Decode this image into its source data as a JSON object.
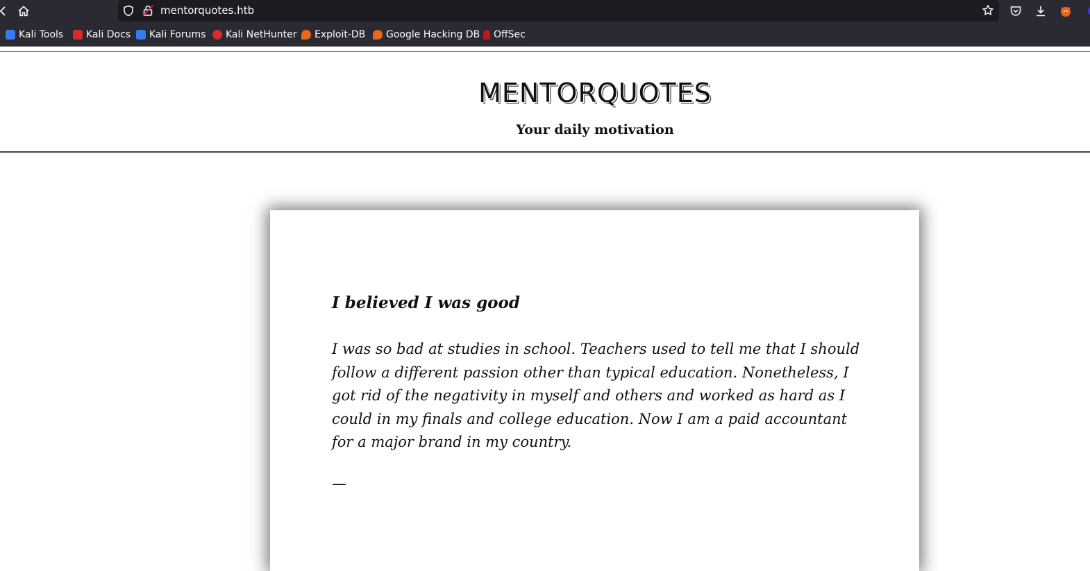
{
  "browser": {
    "url": "mentorquotes.htb",
    "bookmarks": [
      {
        "label": "Kali Tools",
        "color": "#367bf0"
      },
      {
        "label": "Kali Docs",
        "color": "#d62b2b"
      },
      {
        "label": "Kali Forums",
        "color": "#367bf0"
      },
      {
        "label": "Kali NetHunter",
        "color": "#d62b2b"
      },
      {
        "label": "Exploit-DB",
        "color": "#e8671b"
      },
      {
        "label": "Google Hacking DB",
        "color": "#e8671b"
      },
      {
        "label": "OffSec",
        "color": "#c0171c"
      }
    ]
  },
  "site": {
    "title": "MENTORQUOTES",
    "subtitle": "Your daily motivation"
  },
  "quote": {
    "title": "I believed I was good",
    "body": "I was so bad at studies in school. Teachers used to tell me that I should follow a different passion other than typical education. Nonetheless, I got rid of the negativity in myself and others and worked as hard as I could in my finals and college education. Now I am a paid accountant for a major brand in my country.",
    "author": "—"
  }
}
